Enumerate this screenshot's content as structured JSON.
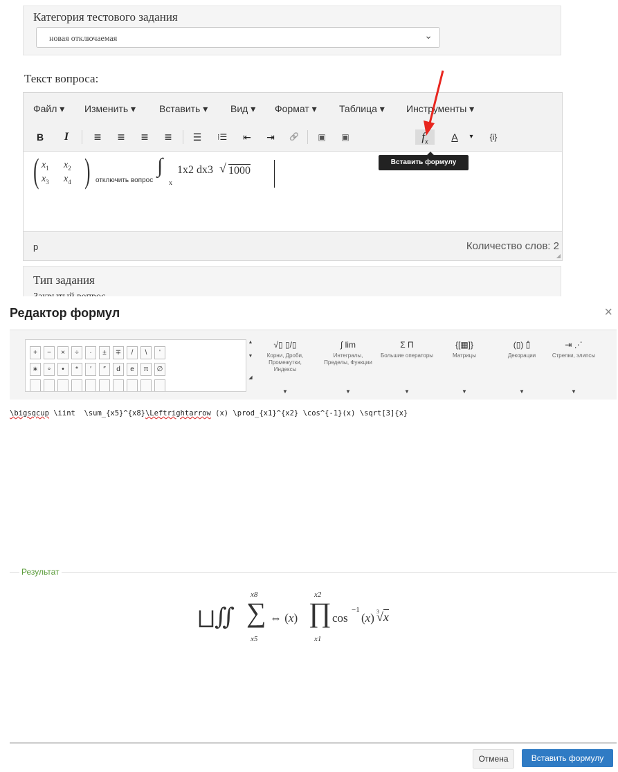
{
  "form": {
    "category_label": "Категория тестового задания",
    "category_value": "новая отключаемая",
    "question_label": "Текст вопроса:",
    "type_label": "Тип задания",
    "type_option_partial": "Закрытый вопрос"
  },
  "editor": {
    "menu": [
      "Файл ▾",
      "Изменить ▾",
      "Вставить ▾",
      "Вид ▾",
      "Формат ▾",
      "Таблица ▾",
      "Инструменты ▾"
    ],
    "toolbar": {
      "bold": "B",
      "italic": "I",
      "align_left": "≡",
      "align_center": "≡",
      "align_right": "≡",
      "justify": "≡",
      "bullets": "☰",
      "numbers": "⁝☰",
      "outdent": "⇤",
      "indent": "⇥",
      "link": "🔗",
      "image": "▣",
      "media": "▣",
      "formula": "f",
      "formula_sub": "x",
      "text_color": "A",
      "dropdown": "▾",
      "code": "{i}"
    },
    "tooltip": "Вставить формулу",
    "content": {
      "matrix": [
        [
          "x",
          "1",
          "x",
          "2"
        ],
        [
          "x",
          "3",
          "x",
          "4"
        ]
      ],
      "subscript_text": "отключить вопрос",
      "integral_sub": "x",
      "formula_text": "1x2 dx3",
      "sqrt_value": "1000"
    },
    "status_path": "p",
    "word_count": "Количество слов: 2"
  },
  "dialog": {
    "title": "Редактор формул",
    "close": "×",
    "symbols_row1": [
      "+",
      "−",
      "×",
      "÷",
      "·",
      "±",
      "∓",
      "/",
      "\\",
      "'"
    ],
    "symbols_row2": [
      "∗",
      "∘",
      "•",
      "*",
      "′",
      "″",
      "d",
      "e",
      "π",
      "∅"
    ],
    "categories": [
      {
        "icon": "√▯ ▯/▯",
        "label": "Корни, Дроби, Промежутки, Индексы"
      },
      {
        "icon": "∫ lim",
        "label": "Интегралы, Пределы, Функции"
      },
      {
        "icon": "Σ Π",
        "label": "Большие операторы"
      },
      {
        "icon": "{[▦]}",
        "label": "Матрицы"
      },
      {
        "icon": "(▯) ▯̂",
        "label": "Декорации"
      },
      {
        "icon": "⇥ ⋰",
        "label": "Стрелки, элипсы"
      }
    ],
    "latex_err": "\\bigsqcup",
    "latex_mid": " \\iint  \\sum_{x5}^{x8}",
    "latex_err2": "\\Leftrightarrow",
    "latex_end": " (x) \\prod_{x1}^{x2} \\cos^{-1}(x) \\sqrt[3]{x}",
    "result_label": "Результат",
    "result": {
      "sum_top": "x8",
      "sum_bottom": "x5",
      "prod_top": "x2",
      "prod_bottom": "x1",
      "cos_exp": "−1",
      "root_index": "3"
    },
    "cancel_label": "Отмена",
    "insert_label": "Вставить формулу"
  },
  "colors": {
    "accent": "#2f7bc4",
    "arrow": "#e8261f",
    "result_label": "#5c9c3c"
  }
}
